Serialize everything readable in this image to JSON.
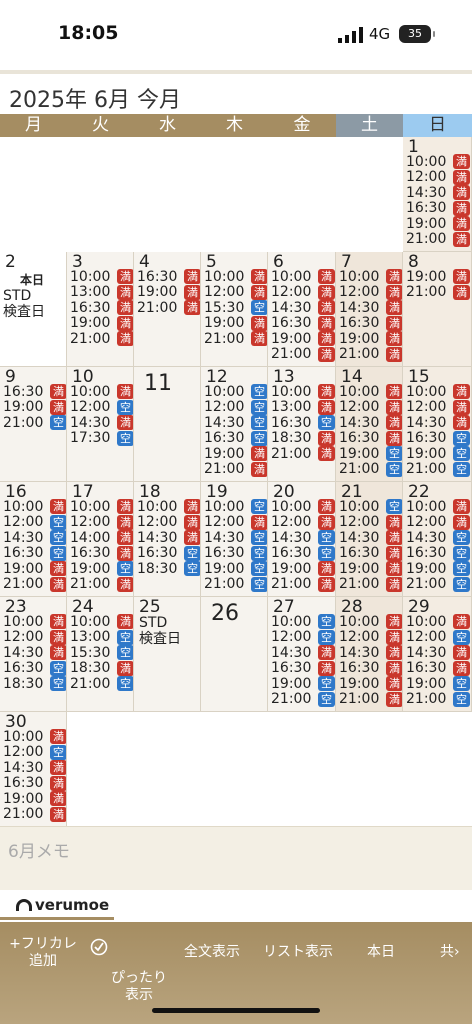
{
  "status_bar": {
    "time": "18:05",
    "network": "4G",
    "battery": "35"
  },
  "header": {
    "month_title": "2025年 6月 今月"
  },
  "weekdays": [
    "月",
    "火",
    "水",
    "木",
    "金",
    "土",
    "日"
  ],
  "legend": {
    "full": "満",
    "vacant": "空"
  },
  "days": [
    {
      "day": "1",
      "slots": [
        [
          "10:00",
          "満"
        ],
        [
          "12:00",
          "満"
        ],
        [
          "14:30",
          "満"
        ],
        [
          "16:30",
          "満"
        ],
        [
          "19:00",
          "満"
        ],
        [
          "21:00",
          "満"
        ]
      ]
    },
    {
      "day": "2",
      "today_label": "本日",
      "notes": [
        "STD",
        "検査日"
      ]
    },
    {
      "day": "3",
      "slots": [
        [
          "10:00",
          "満"
        ],
        [
          "13:00",
          "満"
        ],
        [
          "16:30",
          "満"
        ],
        [
          "19:00",
          "満"
        ],
        [
          "21:00",
          "満"
        ]
      ]
    },
    {
      "day": "4",
      "slots": [
        [
          "16:30",
          "満"
        ],
        [
          "19:00",
          "満"
        ],
        [
          "21:00",
          "満"
        ]
      ]
    },
    {
      "day": "5",
      "slots": [
        [
          "10:00",
          "満"
        ],
        [
          "12:00",
          "満"
        ],
        [
          "15:30",
          "空"
        ],
        [
          "19:00",
          "満"
        ],
        [
          "21:00",
          "満"
        ]
      ]
    },
    {
      "day": "6",
      "slots": [
        [
          "10:00",
          "満"
        ],
        [
          "12:00",
          "満"
        ],
        [
          "14:30",
          "満"
        ],
        [
          "16:30",
          "満"
        ],
        [
          "19:00",
          "満"
        ],
        [
          "21:00",
          "満"
        ]
      ]
    },
    {
      "day": "7",
      "slots": [
        [
          "10:00",
          "満"
        ],
        [
          "12:00",
          "満"
        ],
        [
          "14:30",
          "満"
        ],
        [
          "16:30",
          "満"
        ],
        [
          "19:00",
          "満"
        ],
        [
          "21:00",
          "満"
        ]
      ]
    },
    {
      "day": "8",
      "slots": [
        [
          "19:00",
          "満"
        ],
        [
          "21:00",
          "満"
        ]
      ]
    },
    {
      "day": "9",
      "slots": [
        [
          "16:30",
          "満"
        ],
        [
          "19:00",
          "満"
        ],
        [
          "21:00",
          "空"
        ]
      ]
    },
    {
      "day": "10",
      "slots": [
        [
          "10:00",
          "満"
        ],
        [
          "12:00",
          "空"
        ],
        [
          "14:30",
          "満"
        ],
        [
          "17:30",
          "空"
        ]
      ]
    },
    {
      "day": "11",
      "slots": []
    },
    {
      "day": "12",
      "slots": [
        [
          "10:00",
          "空"
        ],
        [
          "12:00",
          "空"
        ],
        [
          "14:30",
          "空"
        ],
        [
          "16:30",
          "空"
        ],
        [
          "19:00",
          "満"
        ],
        [
          "21:00",
          "満"
        ]
      ]
    },
    {
      "day": "13",
      "slots": [
        [
          "10:00",
          "満"
        ],
        [
          "13:00",
          "満"
        ],
        [
          "16:30",
          "空"
        ],
        [
          "18:30",
          "満"
        ],
        [
          "21:00",
          "満"
        ]
      ]
    },
    {
      "day": "14",
      "slots": [
        [
          "10:00",
          "満"
        ],
        [
          "12:00",
          "満"
        ],
        [
          "14:30",
          "満"
        ],
        [
          "16:30",
          "満"
        ],
        [
          "19:00",
          "空"
        ],
        [
          "21:00",
          "空"
        ]
      ]
    },
    {
      "day": "15",
      "slots": [
        [
          "10:00",
          "満"
        ],
        [
          "12:00",
          "満"
        ],
        [
          "14:30",
          "満"
        ],
        [
          "16:30",
          "空"
        ],
        [
          "19:00",
          "空"
        ],
        [
          "21:00",
          "空"
        ]
      ]
    },
    {
      "day": "16",
      "slots": [
        [
          "10:00",
          "満"
        ],
        [
          "12:00",
          "空"
        ],
        [
          "14:30",
          "空"
        ],
        [
          "16:30",
          "空"
        ],
        [
          "19:00",
          "満"
        ],
        [
          "21:00",
          "満"
        ]
      ]
    },
    {
      "day": "17",
      "slots": [
        [
          "10:00",
          "満"
        ],
        [
          "12:00",
          "満"
        ],
        [
          "14:00",
          "満"
        ],
        [
          "16:30",
          "満"
        ],
        [
          "19:00",
          "空"
        ],
        [
          "21:00",
          "満"
        ]
      ]
    },
    {
      "day": "18",
      "slots": [
        [
          "10:00",
          "満"
        ],
        [
          "12:00",
          "満"
        ],
        [
          "14:30",
          "満"
        ],
        [
          "16:30",
          "空"
        ],
        [
          "18:30",
          "空"
        ]
      ]
    },
    {
      "day": "19",
      "slots": [
        [
          "10:00",
          "空"
        ],
        [
          "12:00",
          "満"
        ],
        [
          "14:30",
          "空"
        ],
        [
          "16:30",
          "空"
        ],
        [
          "19:00",
          "空"
        ],
        [
          "21:00",
          "空"
        ]
      ]
    },
    {
      "day": "20",
      "slots": [
        [
          "10:00",
          "満"
        ],
        [
          "12:00",
          "満"
        ],
        [
          "14:30",
          "空"
        ],
        [
          "16:30",
          "空"
        ],
        [
          "19:00",
          "満"
        ],
        [
          "21:00",
          "満"
        ]
      ]
    },
    {
      "day": "21",
      "slots": [
        [
          "10:00",
          "空"
        ],
        [
          "12:00",
          "満"
        ],
        [
          "14:30",
          "満"
        ],
        [
          "16:30",
          "満"
        ],
        [
          "19:00",
          "満"
        ],
        [
          "21:00",
          "満"
        ]
      ]
    },
    {
      "day": "22",
      "slots": [
        [
          "10:00",
          "満"
        ],
        [
          "12:00",
          "満"
        ],
        [
          "14:30",
          "空"
        ],
        [
          "16:30",
          "空"
        ],
        [
          "19:00",
          "空"
        ],
        [
          "21:00",
          "空"
        ]
      ]
    },
    {
      "day": "23",
      "slots": [
        [
          "10:00",
          "満"
        ],
        [
          "12:00",
          "満"
        ],
        [
          "14:30",
          "満"
        ],
        [
          "16:30",
          "空"
        ],
        [
          "18:30",
          "空"
        ]
      ]
    },
    {
      "day": "24",
      "slots": [
        [
          "10:00",
          "満"
        ],
        [
          "13:00",
          "空"
        ],
        [
          "15:30",
          "空"
        ],
        [
          "18:30",
          "満"
        ],
        [
          "21:00",
          "空"
        ]
      ]
    },
    {
      "day": "25",
      "notes": [
        "STD",
        "検査日"
      ]
    },
    {
      "day": "26",
      "slots": []
    },
    {
      "day": "27",
      "slots": [
        [
          "10:00",
          "空"
        ],
        [
          "12:00",
          "空"
        ],
        [
          "14:30",
          "満"
        ],
        [
          "16:30",
          "満"
        ],
        [
          "19:00",
          "空"
        ],
        [
          "21:00",
          "空"
        ]
      ]
    },
    {
      "day": "28",
      "slots": [
        [
          "10:00",
          "満"
        ],
        [
          "12:00",
          "満"
        ],
        [
          "14:30",
          "満"
        ],
        [
          "16:30",
          "満"
        ],
        [
          "19:00",
          "満"
        ],
        [
          "21:00",
          "満"
        ]
      ]
    },
    {
      "day": "29",
      "slots": [
        [
          "10:00",
          "満"
        ],
        [
          "12:00",
          "空"
        ],
        [
          "14:30",
          "満"
        ],
        [
          "16:30",
          "満"
        ],
        [
          "19:00",
          "空"
        ],
        [
          "21:00",
          "空"
        ]
      ]
    },
    {
      "day": "30",
      "slots": [
        [
          "10:00",
          "満"
        ],
        [
          "12:00",
          "空"
        ],
        [
          "14:30",
          "満"
        ],
        [
          "16:30",
          "満"
        ],
        [
          "19:00",
          "満"
        ],
        [
          "21:00",
          "満"
        ]
      ]
    }
  ],
  "memo": {
    "placeholder": "6月メモ"
  },
  "brand": {
    "name": "verumoe"
  },
  "toolbar": {
    "add_free": "+フリカレ\n追加",
    "fit_view": "ぴったり\n表示",
    "full_text": "全文表示",
    "list_view": "リスト表示",
    "today": "本日",
    "share": "共"
  },
  "colors": {
    "header_brown": "#a58d62",
    "full_red": "#c9372c",
    "vacant_blue": "#2f78c9",
    "sunday_blue": "#9ccbf0",
    "saturday_gray": "#8c9aa5"
  }
}
